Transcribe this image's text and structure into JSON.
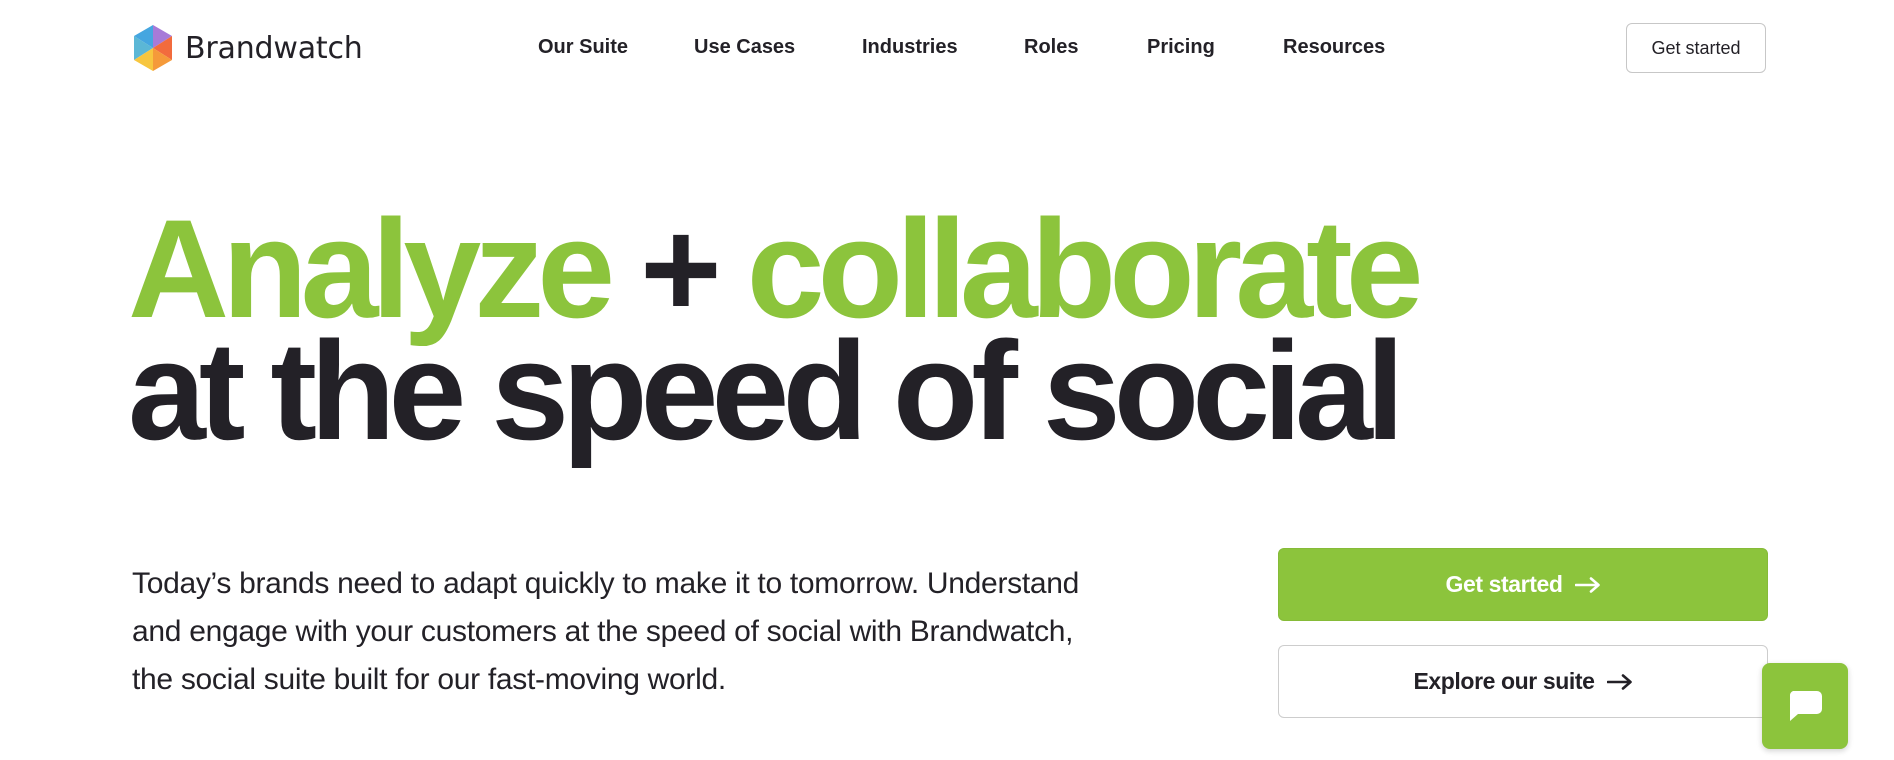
{
  "brand": {
    "name": "Brandwatch",
    "logo_icon": "hexagon-logo-icon",
    "logo_colors": [
      "#45a6e0",
      "#a77ad8",
      "#f7c63f",
      "#f26b3d",
      "#67c3b2"
    ]
  },
  "nav": {
    "items": [
      {
        "label": "Our Suite"
      },
      {
        "label": "Use Cases"
      },
      {
        "label": "Industries"
      },
      {
        "label": "Roles"
      },
      {
        "label": "Pricing"
      },
      {
        "label": "Resources"
      }
    ],
    "cta_label": "Get started"
  },
  "hero": {
    "title_word_1": "Analyze",
    "title_plus": "+",
    "title_word_2": "collaborate",
    "title_line_2": "at the speed of social",
    "description": "Today’s brands need to adapt quickly to make it to tomorrow. Understand and engage with your customers at the speed of social with Brandwatch, the social suite built for our fast-moving world.",
    "primary_button": "Get started",
    "secondary_button": "Explore our suite",
    "arrow_icon": "arrow-right-icon"
  },
  "chat": {
    "icon": "chat-bubble-icon"
  },
  "colors": {
    "accent": "#8cc43c",
    "text": "#232127",
    "border": "#c7c7c7"
  }
}
